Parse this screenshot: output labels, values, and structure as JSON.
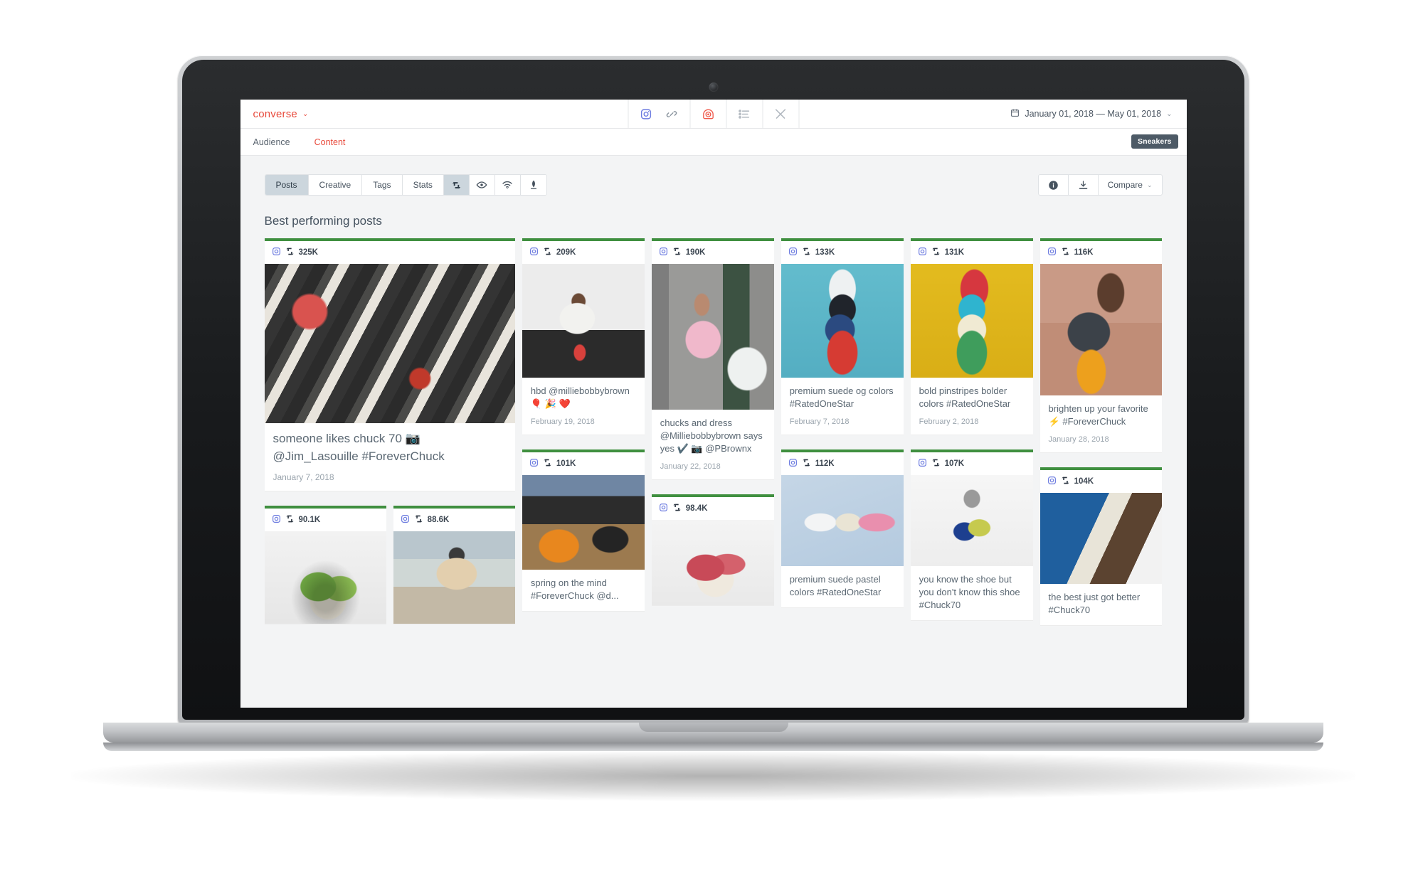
{
  "app": {
    "brand": "converse",
    "brand_caret": "⌄",
    "date_range": "January 01, 2018 — May 01, 2018",
    "date_caret": "⌄",
    "subtabs": [
      {
        "label": "Audience",
        "active": false
      },
      {
        "label": "Content",
        "active": true
      }
    ],
    "tag_badge": "Sneakers",
    "topbar_icons": [
      {
        "name": "instagram-icon"
      },
      {
        "name": "link-icon"
      },
      {
        "name": "target-icon"
      },
      {
        "name": "list-icon"
      },
      {
        "name": "tools-icon"
      }
    ]
  },
  "toolbar": {
    "tabs": [
      {
        "label": "Posts",
        "active": true
      },
      {
        "label": "Creative",
        "active": false
      },
      {
        "label": "Tags",
        "active": false
      },
      {
        "label": "Stats",
        "active": false
      }
    ],
    "icon_tabs": [
      {
        "name": "retweet-icon",
        "active": true
      },
      {
        "name": "eye-icon",
        "active": false
      },
      {
        "name": "signal-icon",
        "active": false
      },
      {
        "name": "feather-icon",
        "active": false
      }
    ],
    "info_label": "",
    "download_label": "",
    "compare_label": "Compare",
    "compare_caret": "⌄"
  },
  "section": {
    "title": "Best performing posts"
  },
  "posts": [
    {
      "id": "post-1",
      "network": "instagram-icon",
      "metric_icon": "retweet-icon",
      "metric": "325K",
      "caption": "someone likes chuck 70 📷 @Jim_Lasouille #ForeverChuck",
      "date": "January 7, 2018",
      "image_alt": "pile of chuck 70 sneakers"
    },
    {
      "id": "post-2",
      "network": "instagram-icon",
      "metric_icon": "retweet-icon",
      "metric": "209K",
      "caption": "hbd @milliebobbybrown 🎈 🎉 ❤️",
      "date": "February 19, 2018",
      "image_alt": "person crouching on steps wearing red sneakers"
    },
    {
      "id": "post-3",
      "network": "instagram-icon",
      "metric_icon": "retweet-icon",
      "metric": "190K",
      "caption": "chucks and dress @Milliebobbybrown says yes ✔️ 📷 @PBrownx",
      "date": "January 22, 2018",
      "image_alt": "person in pink dress with white sneakers"
    },
    {
      "id": "post-4",
      "network": "instagram-icon",
      "metric_icon": "retweet-icon",
      "metric": "133K",
      "caption": "premium suede og colors #RatedOneStar",
      "date": "February 7, 2018",
      "image_alt": "four suede sneakers on blue background"
    },
    {
      "id": "post-5",
      "network": "instagram-icon",
      "metric_icon": "retweet-icon",
      "metric": "131K",
      "caption": "bold pinstripes bolder colors #RatedOneStar",
      "date": "February 2, 2018",
      "image_alt": "four pinstripe sneakers on yellow paper"
    },
    {
      "id": "post-6",
      "network": "instagram-icon",
      "metric_icon": "retweet-icon",
      "metric": "116K",
      "caption": "brighten up your favorite ⚡ #ForeverChuck",
      "date": "January 28, 2018",
      "image_alt": "person seated wearing yellow high tops"
    },
    {
      "id": "post-7",
      "network": "instagram-icon",
      "metric_icon": "retweet-icon",
      "metric": "112K",
      "caption": "premium suede pastel colors #RatedOneStar",
      "date": "",
      "image_alt": "pastel sneakers on blue paper"
    },
    {
      "id": "post-8",
      "network": "instagram-icon",
      "metric_icon": "retweet-icon",
      "metric": "107K",
      "caption": "you know the shoe but you don't know this shoe #Chuck70",
      "date": "",
      "image_alt": "blue and yellow high top sneaker"
    },
    {
      "id": "post-9",
      "network": "instagram-icon",
      "metric_icon": "retweet-icon",
      "metric": "104K",
      "caption": "the best just got better #Chuck70",
      "date": "",
      "image_alt": "close up of blue sneaker toe"
    },
    {
      "id": "post-10",
      "network": "instagram-icon",
      "metric_icon": "retweet-icon",
      "metric": "101K",
      "caption": "spring on the mind #ForeverChuck @d...",
      "date": "",
      "image_alt": "orange and black high tops on steps"
    },
    {
      "id": "post-11",
      "network": "instagram-icon",
      "metric_icon": "retweet-icon",
      "metric": "98.4K",
      "caption": "",
      "date": "",
      "image_alt": "pink low top sneakers"
    },
    {
      "id": "post-12",
      "network": "instagram-icon",
      "metric_icon": "retweet-icon",
      "metric": "90.1K",
      "caption": "",
      "date": "",
      "image_alt": "green low top sneakers"
    },
    {
      "id": "post-13",
      "network": "instagram-icon",
      "metric_icon": "retweet-icon",
      "metric": "88.6K",
      "caption": "",
      "date": "",
      "image_alt": "person in beige hoodie outdoors"
    }
  ],
  "colors": {
    "brand": "#e8493b",
    "card_top_accent": "#3f8f3f",
    "badge": "#4d5a66",
    "canvas": "#f3f4f5"
  }
}
